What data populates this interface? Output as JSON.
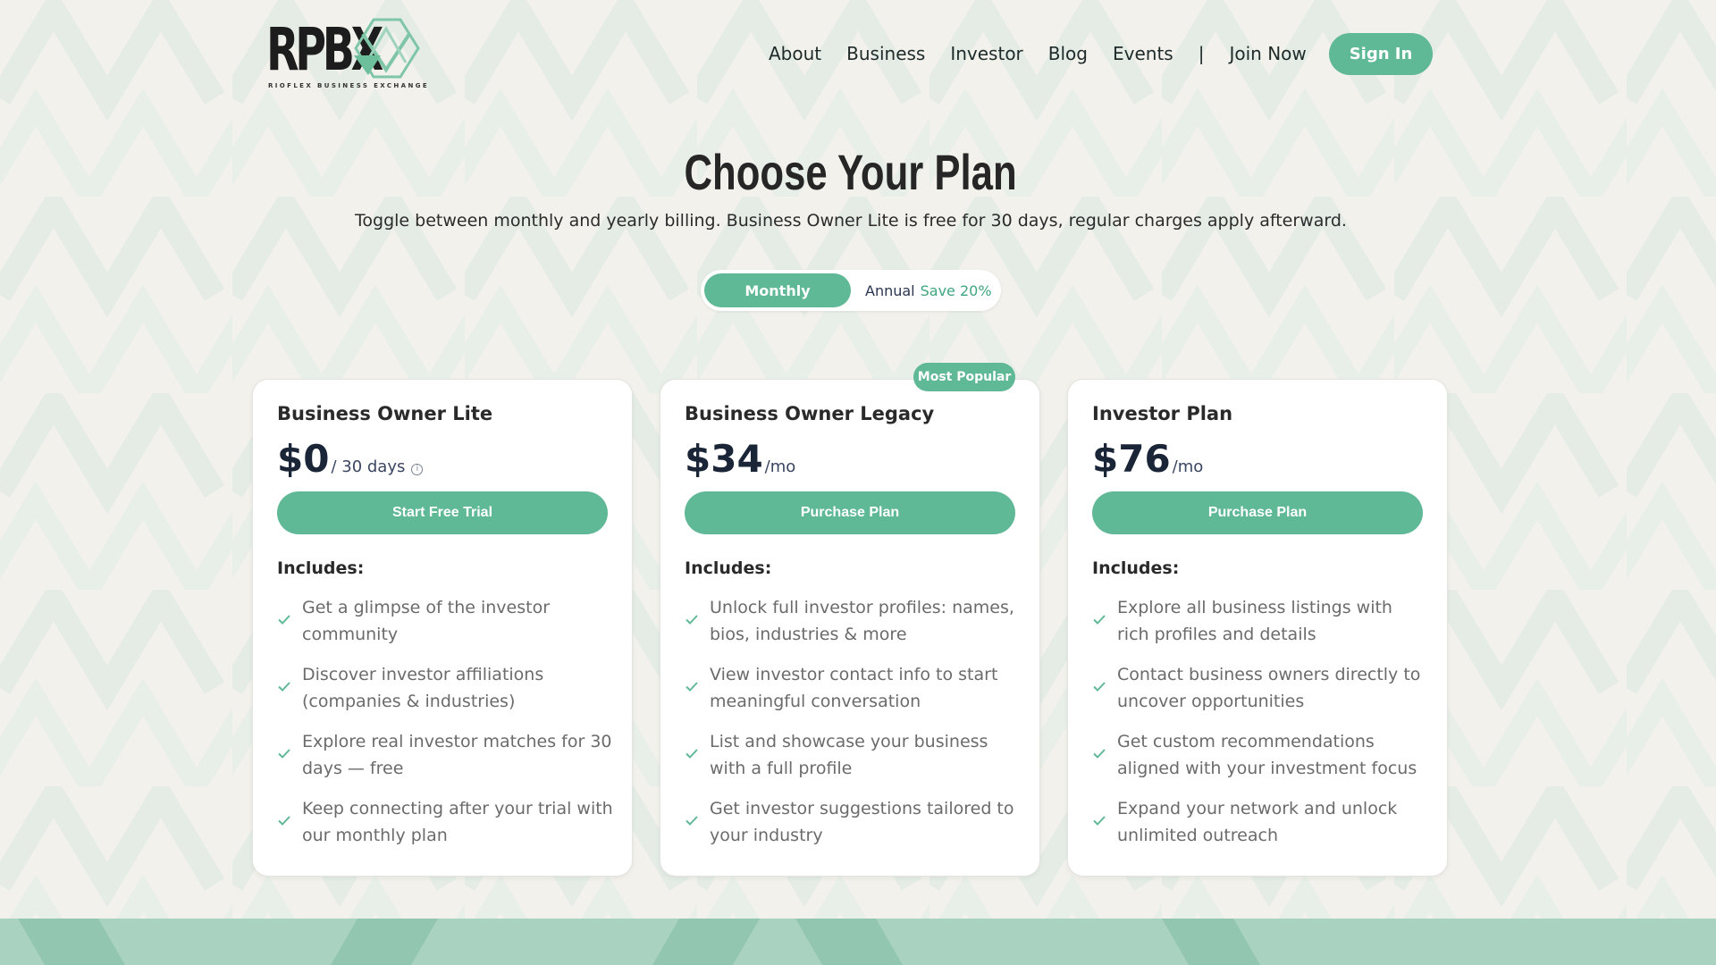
{
  "brand": {
    "logo_text": "RPBX",
    "logo_subtitle": "RIOFLEX BUSINESS EXCHANGE",
    "accent_color": "#5fb896"
  },
  "nav": {
    "items": [
      "About",
      "Business",
      "Investor",
      "Blog",
      "Events"
    ],
    "separator": "|",
    "join_now": "Join Now",
    "sign_in": "Sign In"
  },
  "hero": {
    "title": "Choose Your Plan",
    "subtitle": "Toggle between monthly and yearly billing. Business Owner Lite is free for 30 days, regular charges apply afterward."
  },
  "billing_toggle": {
    "monthly": "Monthly",
    "annual": "Annual",
    "annual_save": "Save 20%",
    "selected": "Monthly"
  },
  "badge": "Most Popular",
  "plans": [
    {
      "name": "Business Owner Lite",
      "amount": "$0",
      "period": "/ 30 days",
      "info_icon": "info-icon",
      "cta": "Start Free Trial",
      "includes_label": "Includes:",
      "features": [
        "Get a glimpse of the investor community",
        "Discover investor affiliations (companies & industries)",
        "Explore real investor matches for 30 days — free",
        "Keep connecting after your trial with our monthly plan"
      ]
    },
    {
      "name": "Business Owner Legacy",
      "amount": "$34",
      "period": "/mo",
      "cta": "Purchase Plan",
      "includes_label": "Includes:",
      "features": [
        "Unlock full investor profiles: names, bios, industries & more",
        "View investor contact info to start meaningful conversation",
        "List and showcase your business with a full profile",
        "Get investor suggestions tailored to your industry"
      ]
    },
    {
      "name": "Investor Plan",
      "amount": "$76",
      "period": "/mo",
      "cta": "Purchase Plan",
      "includes_label": "Includes:",
      "features": [
        "Explore all business listings with rich profiles and details",
        "Contact business owners directly to uncover opportunities",
        "Get custom recommendations aligned with your investment focus",
        "Expand your network and unlock unlimited outreach"
      ]
    }
  ]
}
